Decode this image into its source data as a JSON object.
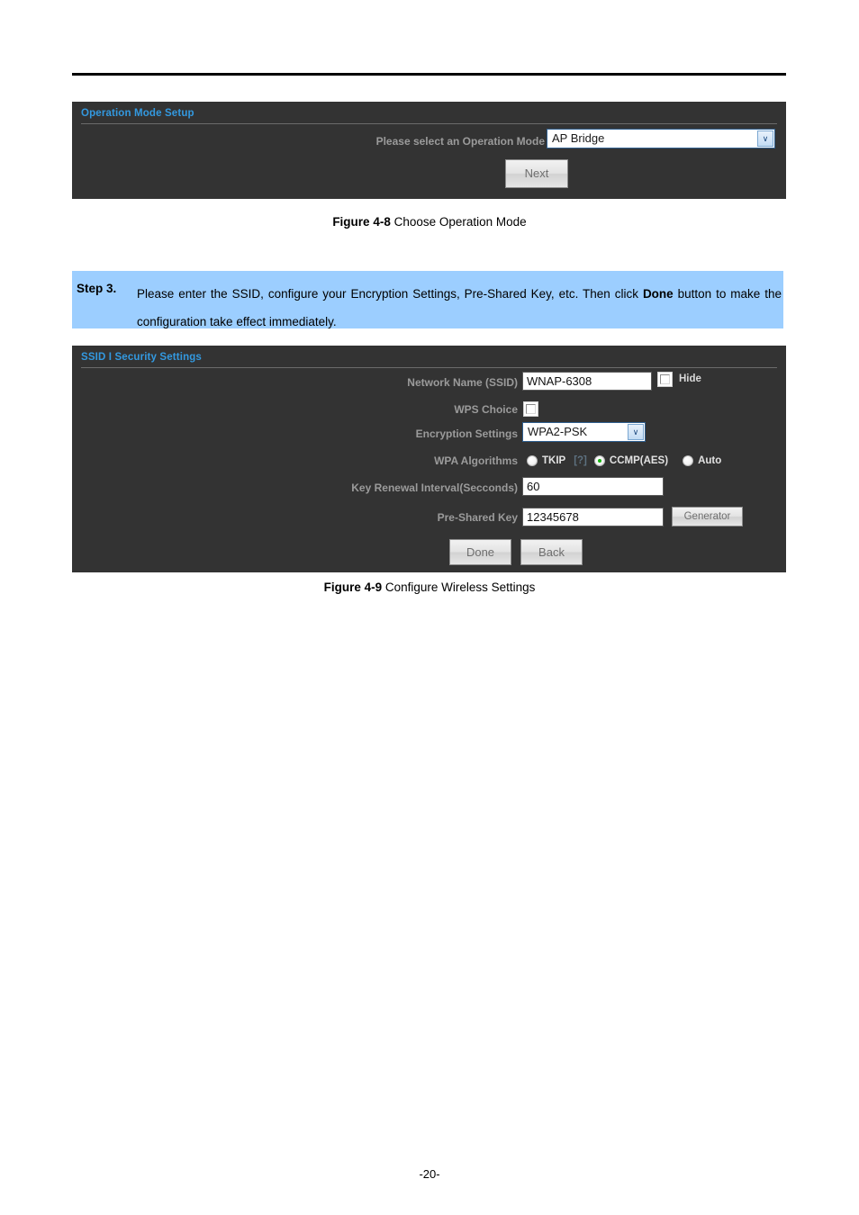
{
  "document": {
    "page_number": "-20-"
  },
  "figure_4_8": {
    "caption_bold": "Figure 4-8",
    "caption_text": " Choose Operation Mode",
    "panel": {
      "header_title": "Operation Mode Setup",
      "operation_mode": {
        "label": "Please select an Operation Mode",
        "value": "AP Bridge",
        "arrow_glyph": "∨"
      },
      "next_button": "Next"
    }
  },
  "step3": {
    "label": "Step 3.",
    "text_part1": "Please enter the SSID, configure your Encryption Settings, Pre-Shared Key, etc. Then click ",
    "text_bold": "Done",
    "text_part2": " button to make the configuration take effect immediately."
  },
  "figure_4_9": {
    "caption_bold": "Figure 4-9",
    "caption_text": " Configure Wireless Settings",
    "panel": {
      "header_title": "SSID I Security Settings",
      "network_name": {
        "label": "Network Name (SSID)",
        "value": "WNAP-6308",
        "hide_label": "Hide"
      },
      "wps_choice": {
        "label": "WPS Choice"
      },
      "encryption_settings": {
        "label": "Encryption Settings",
        "value": "WPA2-PSK",
        "arrow_glyph": "∨"
      },
      "wpa_algorithms": {
        "label": "WPA Algorithms",
        "help_token": "[?]",
        "options": [
          {
            "label": "TKIP",
            "selected": false
          },
          {
            "label": "CCMP(AES)",
            "selected": true
          },
          {
            "label": "Auto",
            "selected": false
          }
        ]
      },
      "key_renewal": {
        "label": "Key Renewal Interval(Secconds)",
        "value": "60"
      },
      "pre_shared_key": {
        "label": "Pre-Shared Key",
        "value": "12345678",
        "generator_button": "Generator"
      },
      "done_button": "Done",
      "back_button": "Back"
    }
  },
  "colors": {
    "panel_background": "#333333",
    "panel_header_text": "#3399e0",
    "field_label": "#9b9b9b",
    "step_box_background": "#9cceff",
    "radio_selected": "#17b40f"
  }
}
